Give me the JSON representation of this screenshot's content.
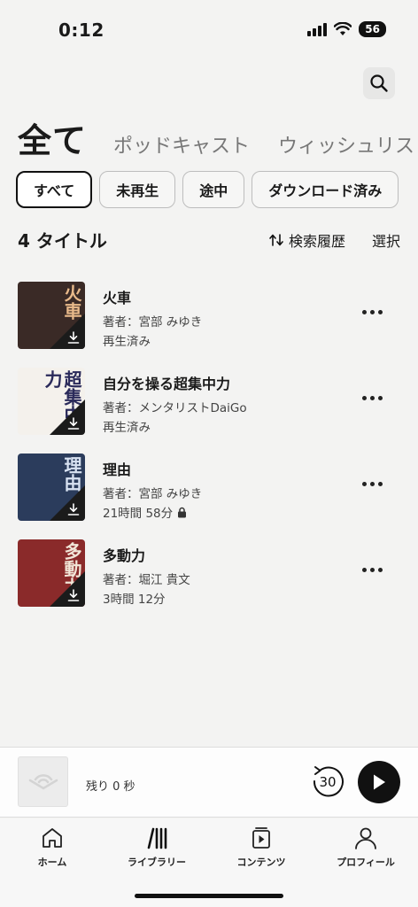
{
  "status": {
    "time": "0:12",
    "battery": "56"
  },
  "tabs": {
    "active": "全て",
    "items": [
      "ポッドキャスト",
      "ウィッシュリスト"
    ]
  },
  "filters": [
    "すべて",
    "未再生",
    "途中",
    "ダウンロード済み"
  ],
  "library": {
    "count_label": "4 タイトル",
    "sort_label": "検索履歴",
    "select_label": "選択"
  },
  "books": [
    {
      "title": "火車",
      "author": "著者：宮部 みゆき",
      "status": "再生済み",
      "cover_text": "火車",
      "cover_bg": "#3a2a26",
      "cover_fg": "#e8b98a",
      "locked": false
    },
    {
      "title": "自分を操る超集中力",
      "author": "著者：メンタリストDaiGo",
      "status": "再生済み",
      "cover_text": "超集中力",
      "cover_bg": "#f4f1ec",
      "cover_fg": "#2a2a5a",
      "locked": false
    },
    {
      "title": "理由",
      "author": "著者：宮部 みゆき",
      "status": "21時間 58分",
      "cover_text": "理由",
      "cover_bg": "#2b3c5c",
      "cover_fg": "#d8e2f2",
      "locked": true
    },
    {
      "title": "多動力",
      "author": "著者：堀江 貴文",
      "status": "3時間 12分",
      "cover_text": "多動力",
      "cover_bg": "#8a2a2a",
      "cover_fg": "#f2e6d8",
      "locked": false
    }
  ],
  "player": {
    "remaining": "残り 0 秒",
    "skip_label": "30"
  },
  "nav": [
    {
      "label": "ホーム",
      "icon": "home-icon"
    },
    {
      "label": "ライブラリー",
      "icon": "library-icon"
    },
    {
      "label": "コンテンツ",
      "icon": "content-icon"
    },
    {
      "label": "プロフィール",
      "icon": "profile-icon"
    }
  ]
}
